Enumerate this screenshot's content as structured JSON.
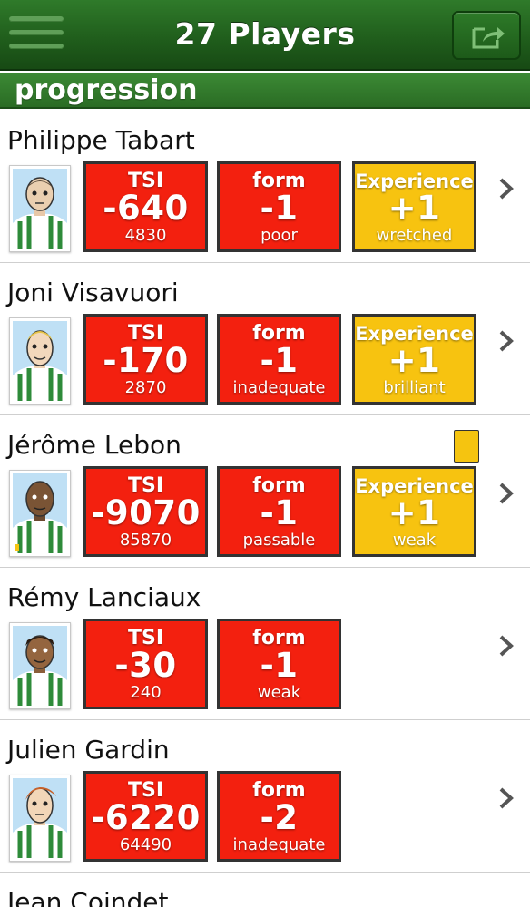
{
  "header": {
    "title": "27 Players"
  },
  "section": {
    "title": "progression"
  },
  "colors": {
    "nav_green": "#1f5c1b",
    "section_green": "#2a6c24",
    "stat_red": "#f3200f",
    "stat_yellow": "#f7c310"
  },
  "players": [
    {
      "name": "Philippe Tabart",
      "tsi": {
        "label": "TSI",
        "change": "-640",
        "value": "4830"
      },
      "form": {
        "label": "form",
        "change": "-1",
        "value": "poor"
      },
      "experience": {
        "label": "Experience",
        "change": "+1",
        "value": "wretched"
      }
    },
    {
      "name": "Joni Visavuori",
      "tsi": {
        "label": "TSI",
        "change": "-170",
        "value": "2870"
      },
      "form": {
        "label": "form",
        "change": "-1",
        "value": "inadequate"
      },
      "experience": {
        "label": "Experience",
        "change": "+1",
        "value": "brilliant"
      }
    },
    {
      "name": "Jérôme Lebon",
      "card": "yellow-card",
      "tsi": {
        "label": "TSI",
        "change": "-9070",
        "value": "85870"
      },
      "form": {
        "label": "form",
        "change": "-1",
        "value": "passable"
      },
      "experience": {
        "label": "Experience",
        "change": "+1",
        "value": "weak"
      }
    },
    {
      "name": "Rémy Lanciaux",
      "tsi": {
        "label": "TSI",
        "change": "-30",
        "value": "240"
      },
      "form": {
        "label": "form",
        "change": "-1",
        "value": "weak"
      }
    },
    {
      "name": "Julien Gardin",
      "tsi": {
        "label": "TSI",
        "change": "-6220",
        "value": "64490"
      },
      "form": {
        "label": "form",
        "change": "-2",
        "value": "inadequate"
      }
    },
    {
      "name": "Jean Coindet"
    }
  ]
}
